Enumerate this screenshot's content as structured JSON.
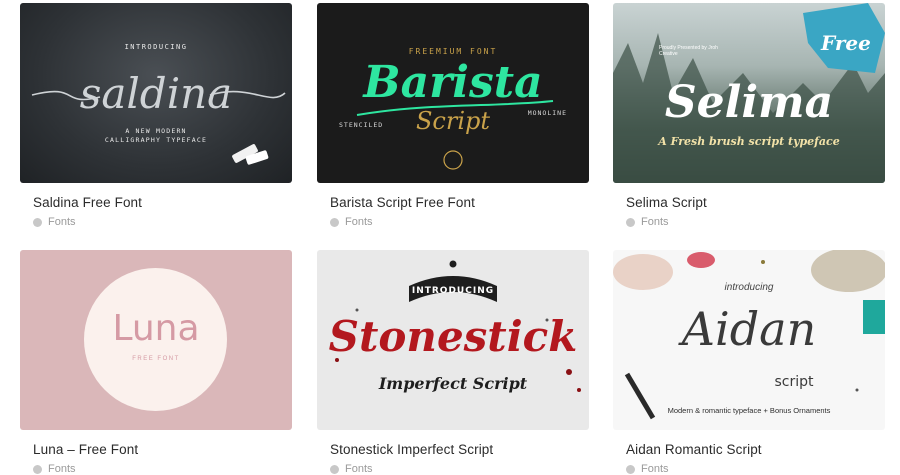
{
  "cards": [
    {
      "title": "Saldina Free Font",
      "category": "Fonts",
      "thumb": {
        "intro": "INTRODUCING",
        "name": "saldina",
        "tagline1": "A NEW MODERN",
        "tagline2": "CALLIGRAPHY TYPEFACE"
      }
    },
    {
      "title": "Barista Script Free Font",
      "category": "Fonts",
      "thumb": {
        "top": "FREEMIUM FONT",
        "name": "Barista",
        "sub": "Script",
        "left": "STENCILED",
        "right": "MONOLINE"
      }
    },
    {
      "title": "Selima Script",
      "category": "Fonts",
      "thumb": {
        "badge": "Free",
        "credit": "Proudly Presented by Jroh Creative",
        "name": "Selima",
        "tagline": "A Fresh brush script typeface"
      }
    },
    {
      "title": "Luna – Free Font",
      "category": "Fonts",
      "thumb": {
        "name": "Luna",
        "sub": "FREE FONT"
      }
    },
    {
      "title": "Stonestick Imperfect Script",
      "category": "Fonts",
      "thumb": {
        "intro": "INTRODUCING",
        "name": "Stonestick",
        "sub": "Imperfect Script"
      }
    },
    {
      "title": "Aidan Romantic Script",
      "category": "Fonts",
      "thumb": {
        "intro": "introducing",
        "name": "Aidan",
        "sub": "script",
        "tagline": "Modern & romantic typeface + Bonus Ornaments"
      }
    }
  ],
  "colors": {
    "saldina_bg": "#2e3236",
    "barista_bg": "#1b1b1b",
    "barista_green": "#2ee6a0",
    "barista_gold": "#c9a24a",
    "selima_blue": "#3aa6c4",
    "luna_bg": "#dab7b9",
    "luna_text": "#d59aa4",
    "stonestick_red": "#b3181e"
  }
}
